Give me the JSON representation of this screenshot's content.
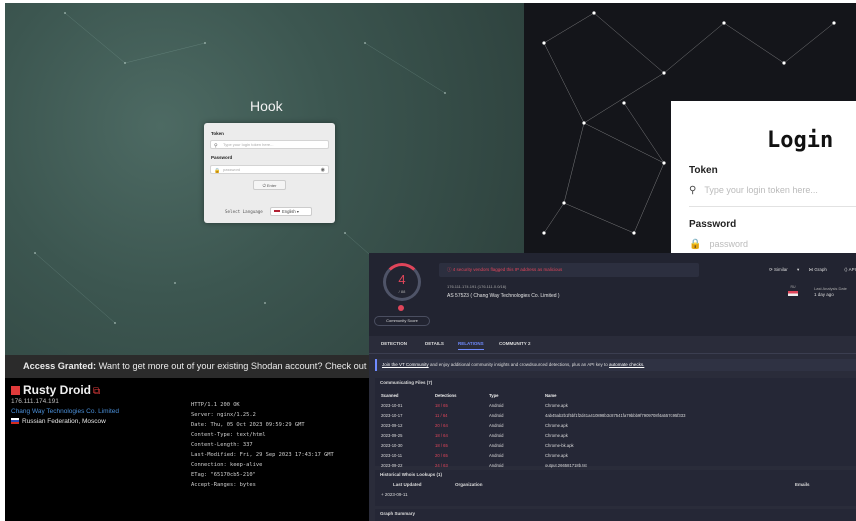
{
  "hook": {
    "title": "Hook",
    "token_label": "Token",
    "token_placeholder": "Type your login token here...",
    "password_label": "Password",
    "password_placeholder": "password",
    "enter_button": "Enter",
    "select_language_label": "Select Language",
    "language": "English"
  },
  "login": {
    "title": "Login",
    "token_label": "Token",
    "token_placeholder": "Type your login token here...",
    "password_label": "Password",
    "password_placeholder": "password"
  },
  "shodan": {
    "banner_bold": "Access Granted:",
    "banner_text": " Want to get more out of your existing Shodan account? Check out",
    "host_name": "Rusty Droid",
    "ip": "176.111.174.191",
    "org": "Chang Way Technologies Co. Limited",
    "country": "Russian Federation, Moscow",
    "response": "HTTP/1.1 200 OK\nServer: nginx/1.25.2\nDate: Thu, 05 Oct 2023 09:59:29 GMT\nContent-Type: text/html\nContent-Length: 337\nLast-Modified: Fri, 29 Sep 2023 17:43:17 GMT\nConnection: keep-alive\nETag: \"65170cb5-210\"\nAccept-Ranges: bytes"
  },
  "vt": {
    "score": "4",
    "total": "/ 88",
    "community_score_label": "Community Score",
    "alert": "4 security vendors flagged this IP address as malicious",
    "actions": [
      "Similar",
      "Graph",
      "API"
    ],
    "meta_line1": "176.111.174.191 (176.111.0.0/16)",
    "meta_line2": "AS 57523 ( Chang Way Technologies Co. Limited )",
    "country_code": "RU",
    "last_analysis_label": "Last Analysis Date",
    "last_analysis_value": "1 day ago",
    "tabs": [
      "DETECTION",
      "DETAILS",
      "RELATIONS",
      "COMMUNITY"
    ],
    "community_count": "2",
    "banner_link": "Join the VT Community",
    "banner_text": " and enjoy additional community insights and crowdsourced detections, plus an API key to ",
    "banner_link2": "automate checks.",
    "files_title": "Communicating Files (7)",
    "files_headers": [
      "Scanned",
      "Detections",
      "Type",
      "Name"
    ],
    "files": [
      [
        "2023-10-01",
        "18 / 65",
        "Android",
        "Chrome.apk"
      ],
      [
        "2023-10-17",
        "11 / 64",
        "Android",
        "4ab45ab2b1f5bf1f2d41a410898b3c87541fa79bbb9f7909708f4a557c95f333"
      ],
      [
        "2023-09-12",
        "20 / 64",
        "Android",
        "Chrome.apk"
      ],
      [
        "2023-09-25",
        "18 / 64",
        "Android",
        "Chrome.apk"
      ],
      [
        "2023-10-30",
        "18 / 65",
        "Android",
        "Chrome-bk.apk"
      ],
      [
        "2023-10-11",
        "20 / 65",
        "Android",
        "Chrome.apk"
      ],
      [
        "2023-09-22",
        "24 / 63",
        "Android",
        "output.266581718b.tst"
      ]
    ],
    "whois_title": "Historical Whois Lookups (1)",
    "whois_headers": [
      "Last Updated",
      "Organization",
      "Emails"
    ],
    "whois_row": "2023-09-11",
    "graph_title": "Graph Summary"
  }
}
